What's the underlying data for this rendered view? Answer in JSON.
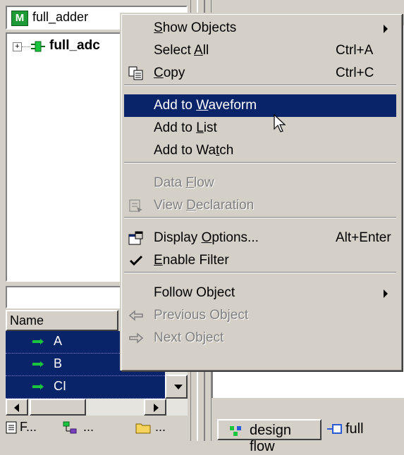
{
  "left_panel": {
    "combo_value": "full_adder",
    "combo_icon": "M",
    "tree_root_label": "full_adc",
    "list_header": "Name",
    "signals": [
      "A",
      "B",
      "CI"
    ],
    "tabs": [
      "F...",
      "...",
      "..."
    ]
  },
  "right_panel": {
    "tabs": [
      "design flow",
      "full"
    ]
  },
  "context_menu": {
    "items": [
      {
        "label_pre": "",
        "label_key": "S",
        "label_post": "how Objects",
        "shortcut": "",
        "submenu": true,
        "disabled": false,
        "icon": ""
      },
      {
        "label_pre": "Select ",
        "label_key": "A",
        "label_post": "ll",
        "shortcut": "Ctrl+A",
        "submenu": false,
        "disabled": false,
        "icon": ""
      },
      {
        "label_pre": "",
        "label_key": "C",
        "label_post": "opy",
        "shortcut": "Ctrl+C",
        "submenu": false,
        "disabled": false,
        "icon": "copy-icon"
      },
      {
        "label_pre": "Add to ",
        "label_key": "W",
        "label_post": "aveform",
        "shortcut": "",
        "submenu": false,
        "disabled": false,
        "icon": "",
        "highlighted": true
      },
      {
        "label_pre": "Add to ",
        "label_key": "L",
        "label_post": "ist",
        "shortcut": "",
        "submenu": false,
        "disabled": false,
        "icon": ""
      },
      {
        "label_pre": "Add to Wa",
        "label_key": "t",
        "label_post": "ch",
        "shortcut": "",
        "submenu": false,
        "disabled": false,
        "icon": ""
      },
      {
        "label_pre": "Data ",
        "label_key": "F",
        "label_post": "low",
        "shortcut": "",
        "submenu": false,
        "disabled": true,
        "icon": ""
      },
      {
        "label_pre": "View ",
        "label_key": "D",
        "label_post": "eclaration",
        "shortcut": "",
        "submenu": false,
        "disabled": true,
        "icon": "view-declaration-icon"
      },
      {
        "label_pre": "Display ",
        "label_key": "O",
        "label_post": "ptions...",
        "shortcut": "Alt+Enter",
        "submenu": false,
        "disabled": false,
        "icon": "display-options-icon"
      },
      {
        "label_pre": "",
        "label_key": "E",
        "label_post": "nable Filter",
        "shortcut": "",
        "submenu": false,
        "disabled": false,
        "icon": "checkmark-icon"
      },
      {
        "label_pre": "Follow Object",
        "label_key": "",
        "label_post": "",
        "shortcut": "",
        "submenu": true,
        "disabled": false,
        "icon": ""
      },
      {
        "label_pre": "Previous Object",
        "label_key": "",
        "label_post": "",
        "shortcut": "",
        "submenu": false,
        "disabled": true,
        "icon": "back-arrow-icon"
      },
      {
        "label_pre": "Next Object",
        "label_key": "",
        "label_post": "",
        "shortcut": "",
        "submenu": false,
        "disabled": true,
        "icon": "forward-arrow-icon"
      }
    ]
  },
  "colors": {
    "highlight": "#0a246a",
    "face": "#d4d0c8",
    "signal_green": "#19c53c"
  }
}
